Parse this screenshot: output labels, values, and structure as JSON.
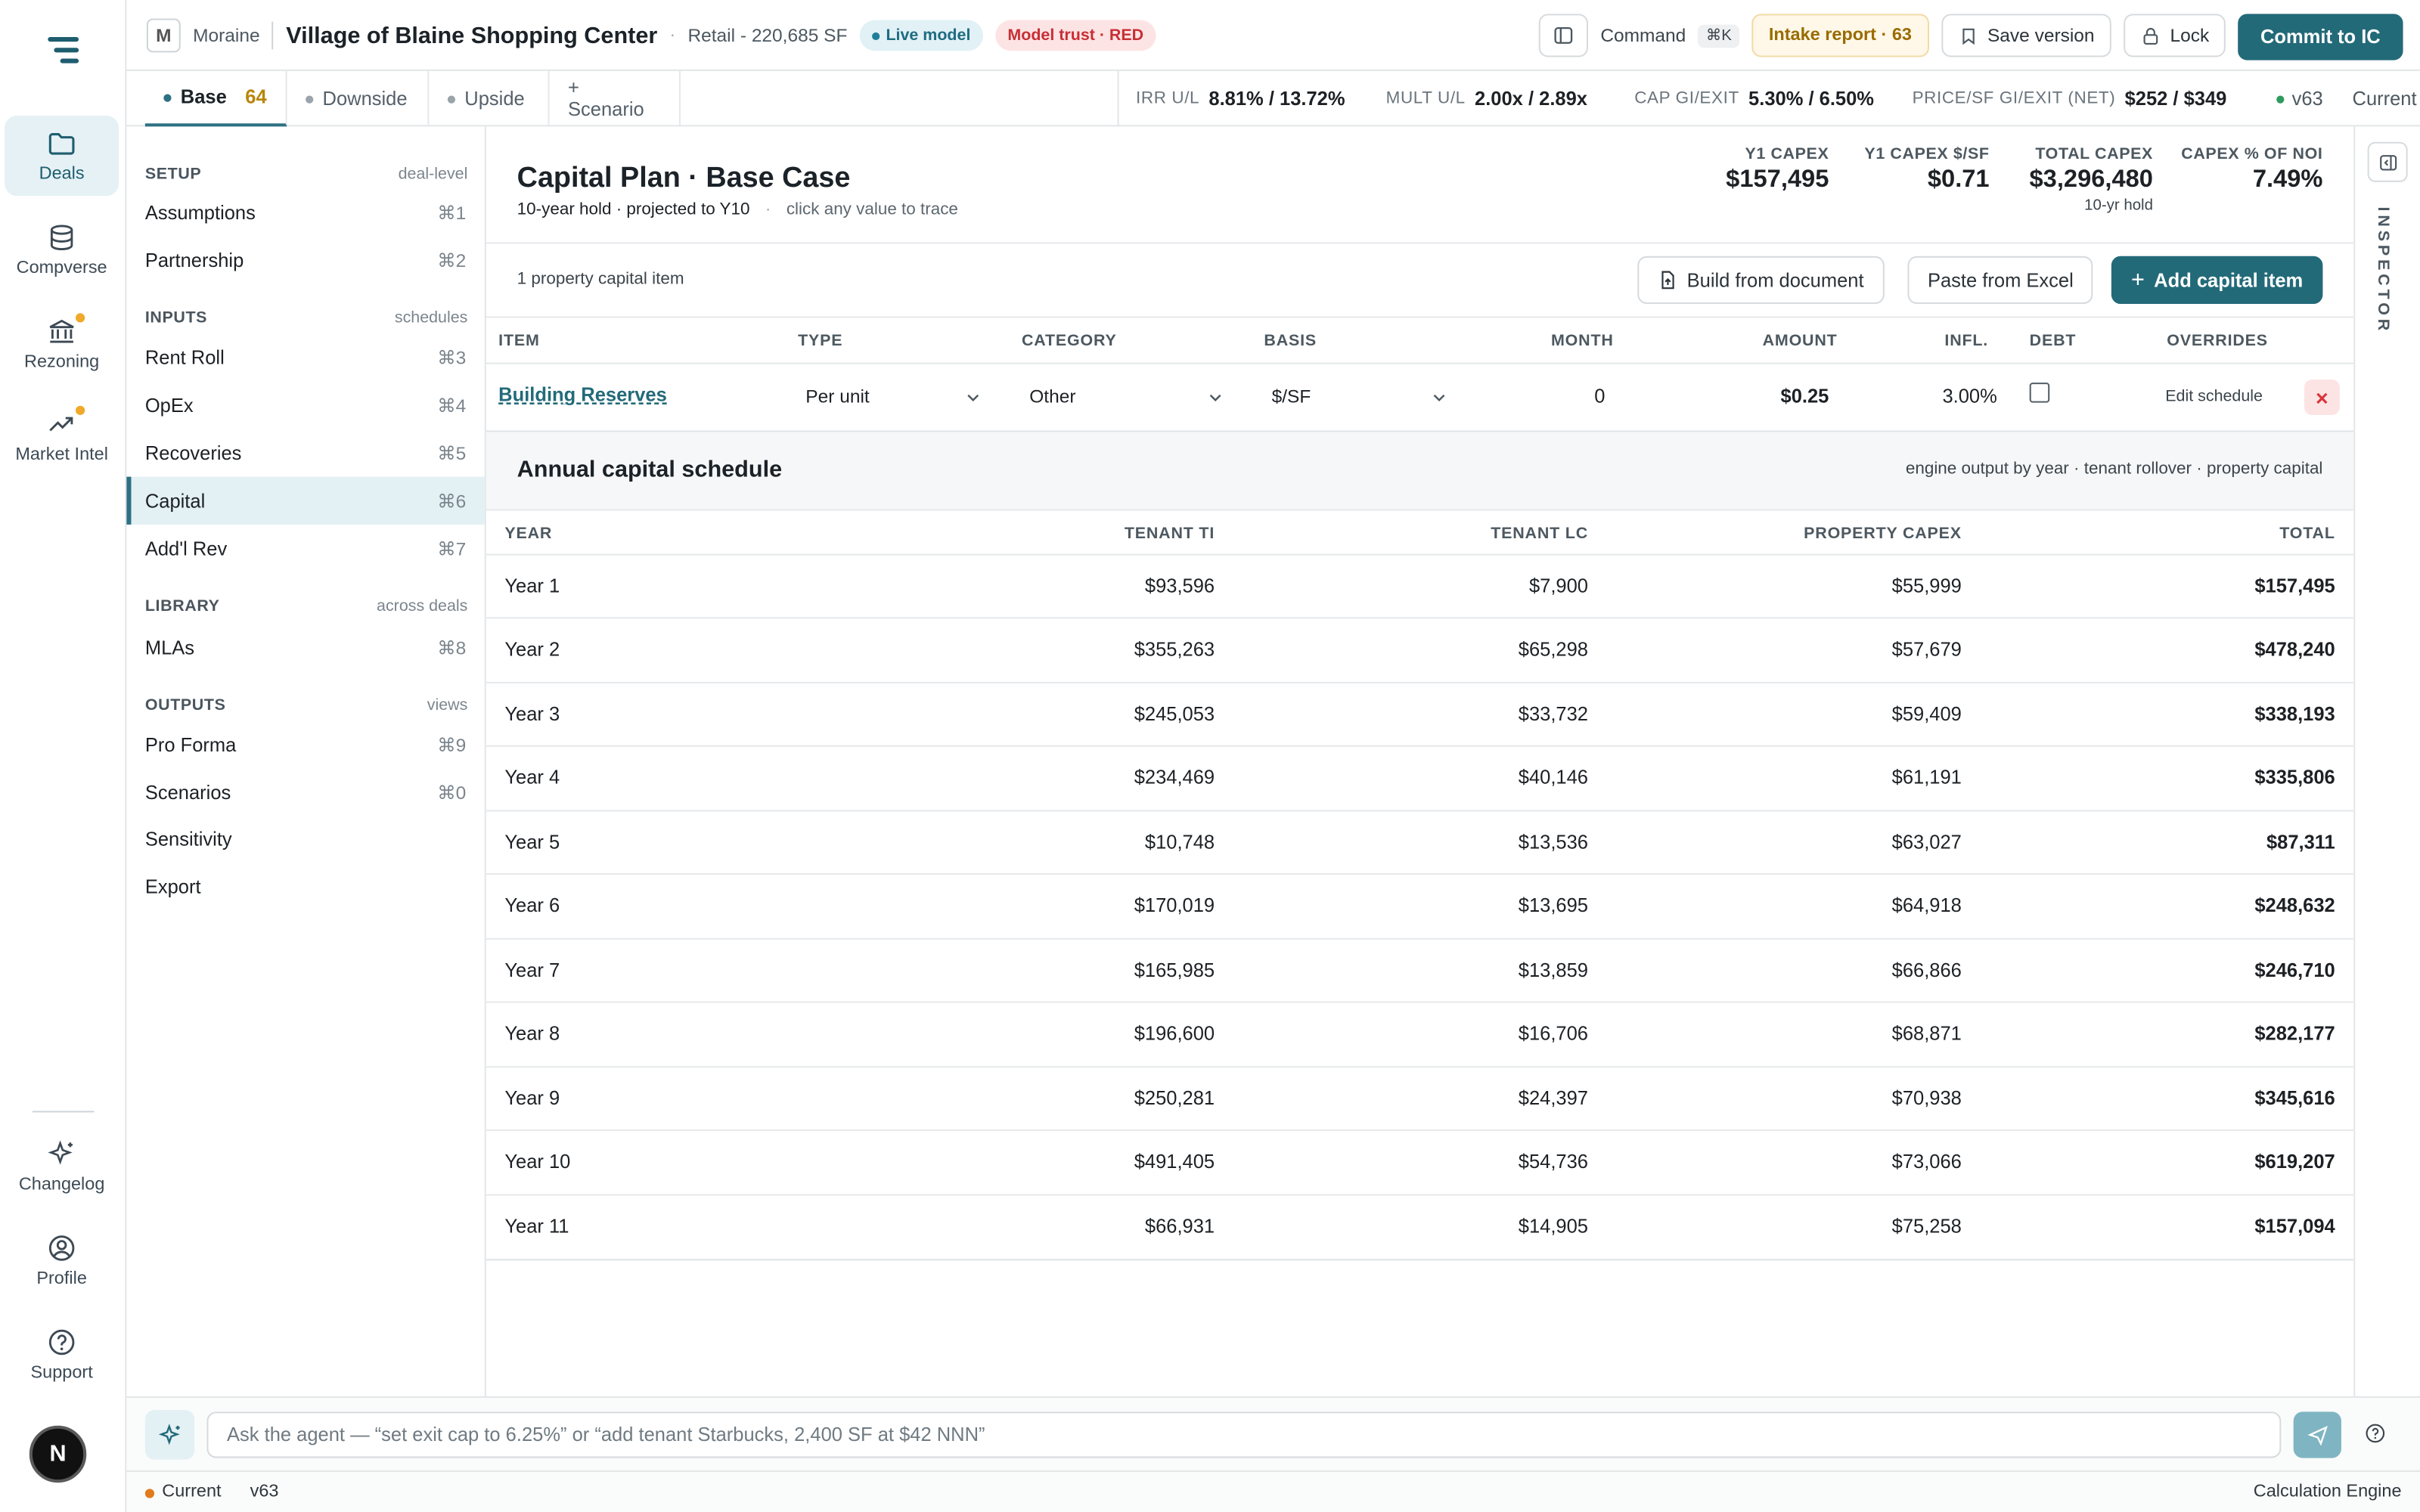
{
  "rail": {
    "items": [
      {
        "label": "Deals",
        "icon": "folder-icon"
      },
      {
        "label": "Compverse",
        "icon": "database-icon"
      },
      {
        "label": "Rezoning",
        "icon": "bank-icon"
      },
      {
        "label": "Market Intel",
        "icon": "trend-icon"
      },
      {
        "label": "Changelog",
        "icon": "sparkle-icon"
      },
      {
        "label": "Profile",
        "icon": "user-icon"
      },
      {
        "label": "Support",
        "icon": "help-icon"
      }
    ],
    "avatar_letter": "N"
  },
  "topbar": {
    "org_initial": "M",
    "org_name": "Moraine",
    "deal_name": "Village of Blaine Shopping Center",
    "sep": "·",
    "asset": "Retail - 220,685 SF",
    "live_badge": "Live model",
    "trust_badge": "Model trust · RED",
    "command_label": "Command",
    "command_kbd": "⌘K",
    "intake_label": "Intake report · 63",
    "save_label": "Save version",
    "lock_label": "Lock",
    "commit_label": "Commit to IC"
  },
  "tabs": {
    "items": [
      {
        "label": "Base",
        "count": "64"
      },
      {
        "label": "Downside"
      },
      {
        "label": "Upside"
      },
      {
        "label": "+ Scenario"
      }
    ],
    "metrics": [
      {
        "key": "IRR U/L",
        "value": "8.81% / 13.72%"
      },
      {
        "key": "MULT U/L",
        "value": "2.00x / 2.89x"
      },
      {
        "key": "CAP GI/EXIT",
        "value": "5.30% / 6.50%"
      },
      {
        "key": "PRICE/SF GI/EXIT (NET)",
        "value": "$252 / $349"
      }
    ],
    "version": "v63",
    "version_state": "Current"
  },
  "sidebar": {
    "sections": [
      {
        "heading": "SETUP",
        "sub": "deal-level",
        "items": [
          {
            "label": "Assumptions",
            "kbd": "⌘1"
          },
          {
            "label": "Partnership",
            "kbd": "⌘2"
          }
        ]
      },
      {
        "heading": "INPUTS",
        "sub": "schedules",
        "items": [
          {
            "label": "Rent Roll",
            "kbd": "⌘3"
          },
          {
            "label": "OpEx",
            "kbd": "⌘4"
          },
          {
            "label": "Recoveries",
            "kbd": "⌘5"
          },
          {
            "label": "Capital",
            "kbd": "⌘6"
          },
          {
            "label": "Add'l Rev",
            "kbd": "⌘7"
          }
        ]
      },
      {
        "heading": "LIBRARY",
        "sub": "across deals",
        "items": [
          {
            "label": "MLAs",
            "kbd": "⌘8"
          }
        ]
      },
      {
        "heading": "OUTPUTS",
        "sub": "views",
        "items": [
          {
            "label": "Pro Forma",
            "kbd": "⌘9"
          },
          {
            "label": "Scenarios",
            "kbd": "⌘0"
          },
          {
            "label": "Sensitivity",
            "kbd": ""
          },
          {
            "label": "Export",
            "kbd": ""
          }
        ]
      }
    ],
    "active": "Capital"
  },
  "main": {
    "title": "Capital Plan · Base Case",
    "subtitle": "10-year hold · projected to Y10",
    "sep": "·",
    "hint": "click any value to trace",
    "stats": [
      {
        "key": "Y1 CAPEX",
        "value": "$157,495",
        "sub": ""
      },
      {
        "key": "Y1 CAPEX $/SF",
        "value": "$0.71",
        "sub": ""
      },
      {
        "key": "TOTAL CAPEX",
        "value": "$3,296,480",
        "sub": "10-yr hold"
      },
      {
        "key": "CAPEX % OF NOI",
        "value": "7.49%",
        "sub": ""
      }
    ],
    "items_count": "1 property capital item",
    "build_label": "Build from document",
    "paste_label": "Paste from Excel",
    "add_label": "Add capital item",
    "item_columns": [
      "ITEM",
      "TYPE",
      "CATEGORY",
      "BASIS",
      "MONTH",
      "AMOUNT",
      "INFL.",
      "DEBT",
      "OVERRIDES"
    ],
    "item": {
      "name": "Building Reserves",
      "type": "Per unit",
      "category": "Other",
      "basis": "$/SF",
      "month": "0",
      "amount": "$0.25",
      "inflation": "3.00%",
      "debt": false,
      "override": "Edit schedule",
      "delete": "×"
    },
    "schedule": {
      "title": "Annual capital schedule",
      "note": "engine output by year · tenant rollover · property capital",
      "columns": [
        "YEAR",
        "TENANT TI",
        "TENANT LC",
        "PROPERTY CAPEX",
        "TOTAL"
      ],
      "rows": [
        [
          "Year 1",
          "$93,596",
          "$7,900",
          "$55,999",
          "$157,495"
        ],
        [
          "Year 2",
          "$355,263",
          "$65,298",
          "$57,679",
          "$478,240"
        ],
        [
          "Year 3",
          "$245,053",
          "$33,732",
          "$59,409",
          "$338,193"
        ],
        [
          "Year 4",
          "$234,469",
          "$40,146",
          "$61,191",
          "$335,806"
        ],
        [
          "Year 5",
          "$10,748",
          "$13,536",
          "$63,027",
          "$87,311"
        ],
        [
          "Year 6",
          "$170,019",
          "$13,695",
          "$64,918",
          "$248,632"
        ],
        [
          "Year 7",
          "$165,985",
          "$13,859",
          "$66,866",
          "$246,710"
        ],
        [
          "Year 8",
          "$196,600",
          "$16,706",
          "$68,871",
          "$282,177"
        ],
        [
          "Year 9",
          "$250,281",
          "$24,397",
          "$70,938",
          "$345,616"
        ],
        [
          "Year 10",
          "$491,405",
          "$54,736",
          "$73,066",
          "$619,207"
        ],
        [
          "Year 11",
          "$66,931",
          "$14,905",
          "$75,258",
          "$157,094"
        ]
      ]
    }
  },
  "inspector": {
    "label": "INSPECTOR"
  },
  "agent": {
    "placeholder": "Ask the agent — “set exit cap to 6.25%” or “add tenant Starbucks, 2,400 SF at $42 NNN”"
  },
  "status": {
    "state": "Current",
    "version": "v63",
    "engine": "Calculation Engine"
  },
  "colors": {
    "accent": "#236a79",
    "live": "#1f7f9a",
    "danger": "#d8353b",
    "warn": "#b8860b"
  }
}
